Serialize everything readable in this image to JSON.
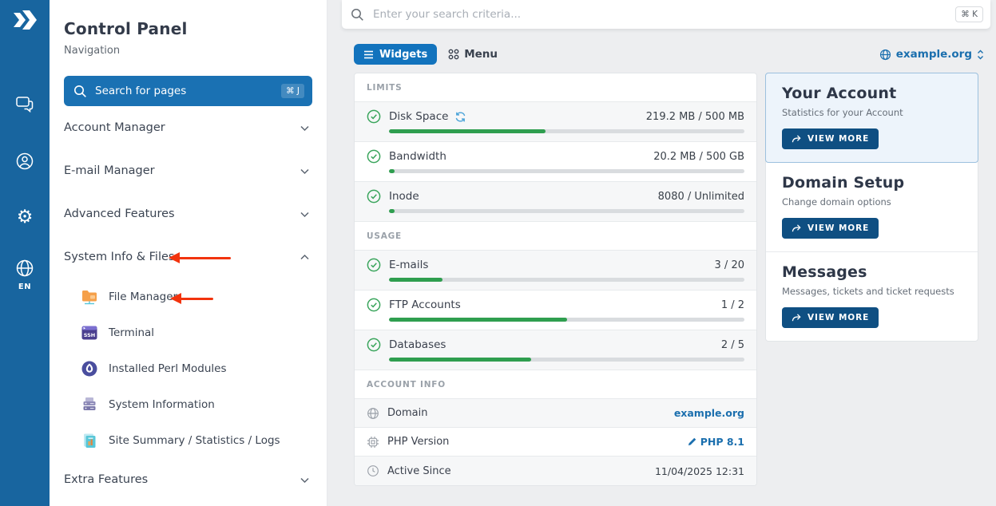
{
  "colors": {
    "rail_blue": "#18659f",
    "primary_blue": "#1a71b3",
    "pill_blue": "#1273bd",
    "button_navy": "#0f4f82",
    "link_blue": "#1b6fae",
    "progress_green": "#2f9e4f",
    "annotation_red": "#f2330d",
    "highlight_card_bg": "#edf4fb"
  },
  "rail": {
    "language": "EN"
  },
  "nav": {
    "title": "Control Panel",
    "subtitle": "Navigation",
    "search": {
      "label": "Search for pages",
      "shortcut": "⌘ J"
    },
    "groups": [
      {
        "label": "Account Manager",
        "expanded": false
      },
      {
        "label": "E-mail Manager",
        "expanded": false
      },
      {
        "label": "Advanced Features",
        "expanded": false
      },
      {
        "label": "System Info & Files",
        "expanded": true,
        "items": [
          {
            "label": "File Manager"
          },
          {
            "label": "Terminal"
          },
          {
            "label": "Installed Perl Modules"
          },
          {
            "label": "System Information"
          },
          {
            "label": "Site Summary / Statistics / Logs"
          }
        ]
      },
      {
        "label": "Extra Features",
        "expanded": false
      }
    ],
    "annotations": [
      {
        "type": "arrow",
        "points_at": "System Info & Files"
      },
      {
        "type": "arrow",
        "points_at": "File Manager"
      }
    ]
  },
  "topbar": {
    "search_placeholder": "Enter your search criteria...",
    "shortcut": "⌘ K"
  },
  "toolbar": {
    "widgets_label": "Widgets",
    "menu_label": "Menu",
    "domain": "example.org"
  },
  "stats": {
    "limits": {
      "header": "LIMITS",
      "rows": [
        {
          "label": "Disk Space",
          "value": "219.2 MB / 500 MB",
          "progress": 44,
          "has_refresh": true
        },
        {
          "label": "Bandwidth",
          "value": "20.2 MB / 500 GB",
          "progress": 1.5
        },
        {
          "label": "Inode",
          "value": "8080 / Unlimited",
          "progress": 1.5
        }
      ]
    },
    "usage": {
      "header": "USAGE",
      "rows": [
        {
          "label": "E-mails",
          "value": "3 / 20",
          "progress": 15
        },
        {
          "label": "FTP Accounts",
          "value": "1 / 2",
          "progress": 50
        },
        {
          "label": "Databases",
          "value": "2 / 5",
          "progress": 40
        }
      ]
    },
    "account_info": {
      "header": "ACCOUNT INFO",
      "rows": [
        {
          "label": "Domain",
          "value": "example.org",
          "icon": "globe-icon",
          "value_style": "link"
        },
        {
          "label": "PHP Version",
          "value": "PHP 8.1",
          "icon": "chip-icon",
          "value_style": "link-edit"
        },
        {
          "label": "Active Since",
          "value": "11/04/2025 12:31",
          "icon": "clock-icon",
          "value_style": "text"
        }
      ]
    }
  },
  "side_cards": [
    {
      "title": "Your Account",
      "subtitle": "Statistics for your Account",
      "button_label": "VIEW MORE",
      "highlighted": true
    },
    {
      "title": "Domain Setup",
      "subtitle": "Change domain options",
      "button_label": "VIEW MORE",
      "highlighted": false
    },
    {
      "title": "Messages",
      "subtitle": "Messages, tickets and ticket requests",
      "button_label": "VIEW MORE",
      "highlighted": false
    }
  ]
}
